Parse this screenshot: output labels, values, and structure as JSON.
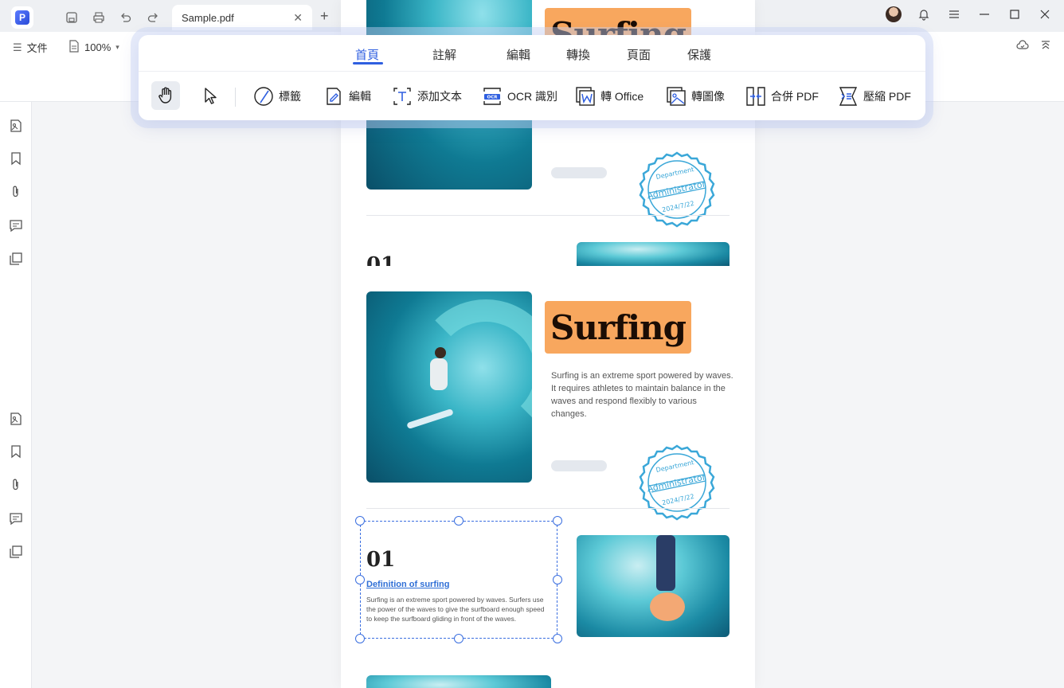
{
  "titlebar": {
    "tab_title": "Sample.pdf",
    "tab_close": "✕",
    "tab_add": "+",
    "icons": [
      "save-icon",
      "print-icon",
      "undo-icon",
      "redo-icon",
      "dropdown-icon"
    ]
  },
  "toolbar2": {
    "file_label": "文件",
    "zoom_value": "100%"
  },
  "ribbon": {
    "tabs": [
      {
        "label": "首頁",
        "active": true
      },
      {
        "label": "註解",
        "active": false
      },
      {
        "label": "編輯",
        "active": false
      },
      {
        "label": "轉換",
        "active": false
      },
      {
        "label": "頁面",
        "active": false
      },
      {
        "label": "保護",
        "active": false
      }
    ],
    "tools": [
      {
        "label": "標籤",
        "icon": "label-icon"
      },
      {
        "label": "編輯",
        "icon": "edit-icon"
      },
      {
        "label": "添加文本",
        "icon": "add-text-icon"
      },
      {
        "label": "OCR 識別",
        "icon": "ocr-icon"
      },
      {
        "label": "轉 Office",
        "icon": "to-office-icon"
      },
      {
        "label": "轉圖像",
        "icon": "to-image-icon"
      },
      {
        "label": "合併 PDF",
        "icon": "merge-pdf-icon"
      },
      {
        "label": "壓縮 PDF",
        "icon": "compress-pdf-icon"
      }
    ],
    "accent": "#2f5fe0"
  },
  "document": {
    "title": "Surfing",
    "desc_lines": [
      "Surfing is an extreme sport powered by waves.",
      "It requires athletes to maintain balance in the",
      "waves and respond flexibly to various changes."
    ],
    "stamp": {
      "top": "Department",
      "middle": "Administrator",
      "date": "2024/7/22",
      "color": "#3aa7d8"
    },
    "section_number": "01",
    "section_title": "Definition of surfing",
    "section_text": "Surfing is an extreme sport powered by waves. Surfers use the power of the waves to give the surfboard enough speed to keep the surfboard gliding in front of the waves.",
    "title_bg": "#f8a75e"
  }
}
